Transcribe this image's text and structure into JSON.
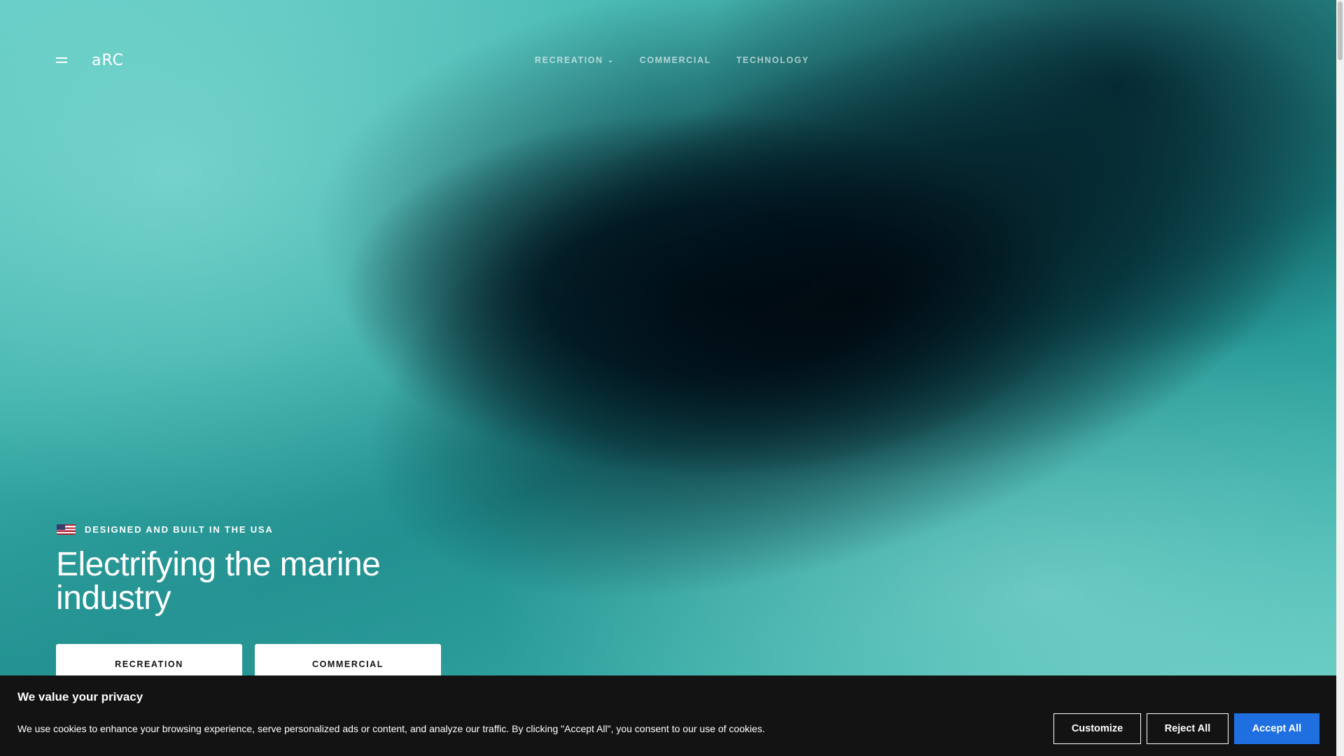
{
  "header": {
    "logo_text": "aRC",
    "nav": [
      {
        "label": "RECREATION",
        "has_dropdown": true
      },
      {
        "label": "COMMERCIAL",
        "has_dropdown": false
      },
      {
        "label": "TECHNOLOGY",
        "has_dropdown": false
      }
    ],
    "chevron": "⌄"
  },
  "hero": {
    "eyebrow": "DESIGNED AND BUILT IN THE USA",
    "headline": "Electrifying the marine industry",
    "buttons": {
      "recreation": "RECREATION",
      "commercial": "COMMERCIAL"
    }
  },
  "cookie_banner": {
    "title": "We value your privacy",
    "text": "We use cookies to enhance your browsing experience, serve personalized ads or content, and analyze our traffic. By clicking \"Accept All\", you consent to our use of cookies.",
    "customize_label": "Customize",
    "reject_label": "Reject All",
    "accept_label": "Accept All",
    "accept_color": "#1f6fe0"
  },
  "icons": {
    "menu": "hamburger-icon",
    "flag": "us-flag-icon",
    "chevron": "chevron-down-icon"
  }
}
